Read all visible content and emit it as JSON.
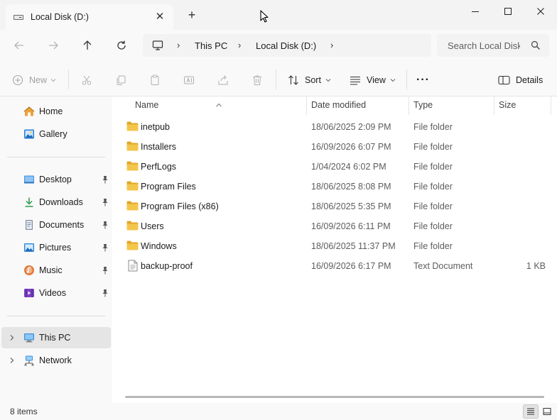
{
  "window": {
    "tab_title": "Local Disk (D:)",
    "tab_close_glyph": "✕",
    "new_tab_glyph": "+"
  },
  "address": {
    "crumbs": [
      "This PC",
      "Local Disk (D:)"
    ],
    "separator": "›"
  },
  "search": {
    "placeholder": "Search Local Disk (D:)"
  },
  "commands": {
    "new_label": "New",
    "sort_label": "Sort",
    "view_label": "View",
    "more_glyph": "···",
    "details_label": "Details"
  },
  "sidebar": {
    "top_items": [
      {
        "label": "Home",
        "icon": "home-icon"
      },
      {
        "label": "Gallery",
        "icon": "gallery-icon"
      }
    ],
    "quick_items": [
      {
        "label": "Desktop",
        "icon": "desktop-icon",
        "pinned": true
      },
      {
        "label": "Downloads",
        "icon": "downloads-icon",
        "pinned": true
      },
      {
        "label": "Documents",
        "icon": "documents-icon",
        "pinned": true
      },
      {
        "label": "Pictures",
        "icon": "pictures-icon",
        "pinned": true
      },
      {
        "label": "Music",
        "icon": "music-icon",
        "pinned": true
      },
      {
        "label": "Videos",
        "icon": "videos-icon",
        "pinned": true
      }
    ],
    "bottom_items": [
      {
        "label": "This PC",
        "icon": "this-pc-icon",
        "selected": true
      },
      {
        "label": "Network",
        "icon": "network-icon",
        "selected": false
      }
    ]
  },
  "columns": {
    "name": "Name",
    "date": "Date modified",
    "type": "Type",
    "size": "Size"
  },
  "files": [
    {
      "name": "inetpub",
      "date": "18/06/2025 2:09 PM",
      "type": "File folder",
      "size": "",
      "kind": "folder"
    },
    {
      "name": "Installers",
      "date": "16/09/2026 6:07 PM",
      "type": "File folder",
      "size": "",
      "kind": "folder"
    },
    {
      "name": "PerfLogs",
      "date": "1/04/2024 6:02 PM",
      "type": "File folder",
      "size": "",
      "kind": "folder"
    },
    {
      "name": "Program Files",
      "date": "18/06/2025 8:08 PM",
      "type": "File folder",
      "size": "",
      "kind": "folder"
    },
    {
      "name": "Program Files (x86)",
      "date": "18/06/2025 5:35 PM",
      "type": "File folder",
      "size": "",
      "kind": "folder"
    },
    {
      "name": "Users",
      "date": "16/09/2026 6:11 PM",
      "type": "File folder",
      "size": "",
      "kind": "folder"
    },
    {
      "name": "Windows",
      "date": "18/06/2025 11:37 PM",
      "type": "File folder",
      "size": "",
      "kind": "folder"
    },
    {
      "name": "backup-proof",
      "date": "16/09/2026 6:17 PM",
      "type": "Text Document",
      "size": "1 KB",
      "kind": "text"
    }
  ],
  "status": {
    "item_count": "8 items"
  },
  "colors": {
    "folder": "#f3c64b",
    "folder_dark": "#e2a82a",
    "accent": "#0067c0"
  }
}
